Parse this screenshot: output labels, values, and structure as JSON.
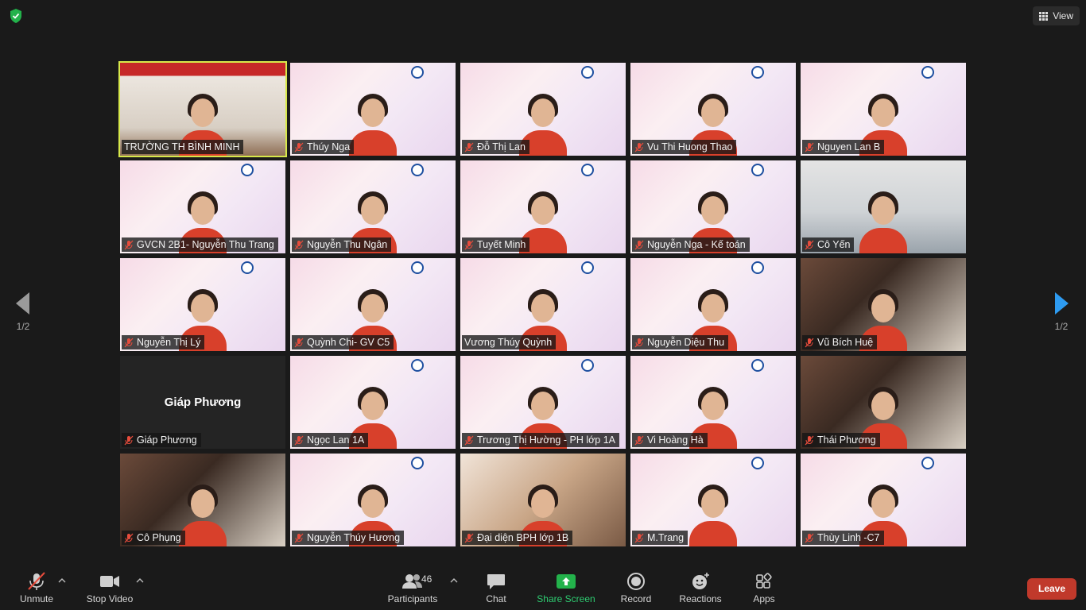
{
  "topbar": {
    "view_label": "View"
  },
  "pager": {
    "left_label": "1/2",
    "right_label": "1/2"
  },
  "colors": {
    "active_outline": "#d7e84a",
    "share_green": "#2ecc71",
    "leave_red": "#c0392b",
    "muted_red": "#e74c3c"
  },
  "tiles": [
    {
      "name": "TRƯỜNG TH BÌNH MINH",
      "muted": false,
      "active": true,
      "style": "room"
    },
    {
      "name": "Thúy Nga",
      "muted": true,
      "style": "poster"
    },
    {
      "name": "Đỗ Thị Lan",
      "muted": true,
      "style": "poster"
    },
    {
      "name": "Vu Thi Huong Thao",
      "muted": true,
      "style": "poster"
    },
    {
      "name": "Nguyen Lan B",
      "muted": true,
      "style": "poster"
    },
    {
      "name": "GVCN 2B1- Nguyễn Thu Trang",
      "muted": true,
      "style": "poster"
    },
    {
      "name": "Nguyễn Thu Ngân",
      "muted": true,
      "style": "poster"
    },
    {
      "name": "Tuyết Minh",
      "muted": true,
      "style": "poster"
    },
    {
      "name": "Nguyễn Nga - Kế toán",
      "muted": true,
      "style": "poster"
    },
    {
      "name": "Cô Yến",
      "muted": true,
      "style": "office"
    },
    {
      "name": "Nguyễn Thị Lý",
      "muted": true,
      "style": "poster"
    },
    {
      "name": "Quỳnh Chi- GV C5",
      "muted": true,
      "style": "poster"
    },
    {
      "name": "Vương Thúy Quỳnh",
      "muted": false,
      "style": "poster"
    },
    {
      "name": "Nguyễn Diệu Thu",
      "muted": true,
      "style": "poster"
    },
    {
      "name": "Vũ Bích Huệ",
      "muted": true,
      "style": "home"
    },
    {
      "name": "Giáp Phương",
      "muted": true,
      "style": "nocam",
      "center_name": "Giáp Phương"
    },
    {
      "name": "Ngọc Lan 1A",
      "muted": true,
      "style": "poster"
    },
    {
      "name": "Trương Thị Hường - PH lớp 1A",
      "muted": true,
      "style": "poster"
    },
    {
      "name": "Vi Hoàng Hà",
      "muted": true,
      "style": "poster"
    },
    {
      "name": "Thái Phương",
      "muted": true,
      "style": "home"
    },
    {
      "name": "Cô Phụng",
      "muted": true,
      "style": "home"
    },
    {
      "name": "Nguyễn Thúy Hương",
      "muted": true,
      "style": "poster"
    },
    {
      "name": "Đại diện BPH lớp 1B",
      "muted": true,
      "style": "kids"
    },
    {
      "name": "M.Trang",
      "muted": true,
      "style": "poster"
    },
    {
      "name": "Thùy Linh -C7",
      "muted": true,
      "style": "poster"
    }
  ],
  "toolbar": {
    "unmute": "Unmute",
    "stop_video": "Stop Video",
    "participants": "Participants",
    "participants_count": "46",
    "chat": "Chat",
    "share_screen": "Share Screen",
    "record": "Record",
    "reactions": "Reactions",
    "apps": "Apps",
    "leave": "Leave"
  }
}
